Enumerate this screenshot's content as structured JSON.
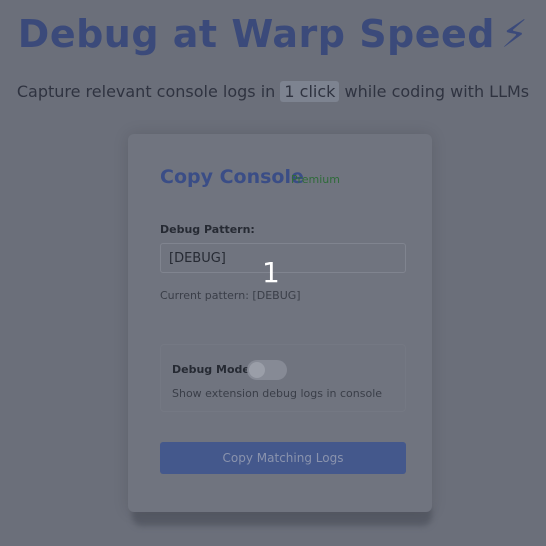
{
  "hero": {
    "title": "Debug at Warp Speed",
    "bolt_icon": "lightning-icon",
    "subtitle_before": "Capture relevant console logs in",
    "subtitle_highlight": "1 click",
    "subtitle_after": "while coding with LLMs"
  },
  "popup": {
    "title": "Copy Console",
    "badge": "Premium",
    "pattern_label": "Debug Pattern:",
    "pattern_value": "[DEBUG]",
    "current_pattern": "Current pattern: [DEBUG]",
    "debug_mode_label": "Debug Mode",
    "debug_mode_on": false,
    "debug_mode_desc": "Show extension debug logs in console",
    "copy_button": "Copy Matching Logs"
  },
  "overlay": {
    "step_number": "1"
  },
  "colors": {
    "background": "#6b6f7a",
    "accent": "#3a4d86",
    "button": "#44588c",
    "premium": "#2f6b3a"
  }
}
